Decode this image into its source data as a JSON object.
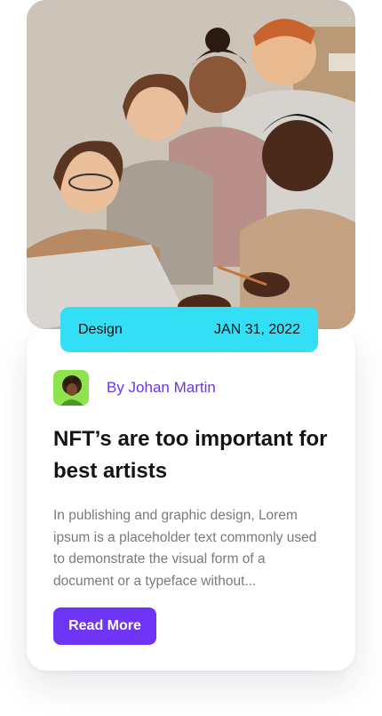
{
  "post": {
    "category": "Design",
    "date": "JAN 31, 2022",
    "author": "By Johan Martin",
    "title": "NFT’s are too important for best artists",
    "excerpt": "In publishing and graphic design, Lorem ipsum is a placeholder text commonly used to demonstrate the visual form of a document or a typeface without...",
    "cta_label": "Read More"
  },
  "colors": {
    "tag_bg": "#32dff5",
    "author": "#6b35e8",
    "button": "#6e35f7",
    "avatar_bg": "#8fe34d"
  },
  "icons": {
    "photo": "team-photo",
    "avatar": "author-avatar"
  }
}
